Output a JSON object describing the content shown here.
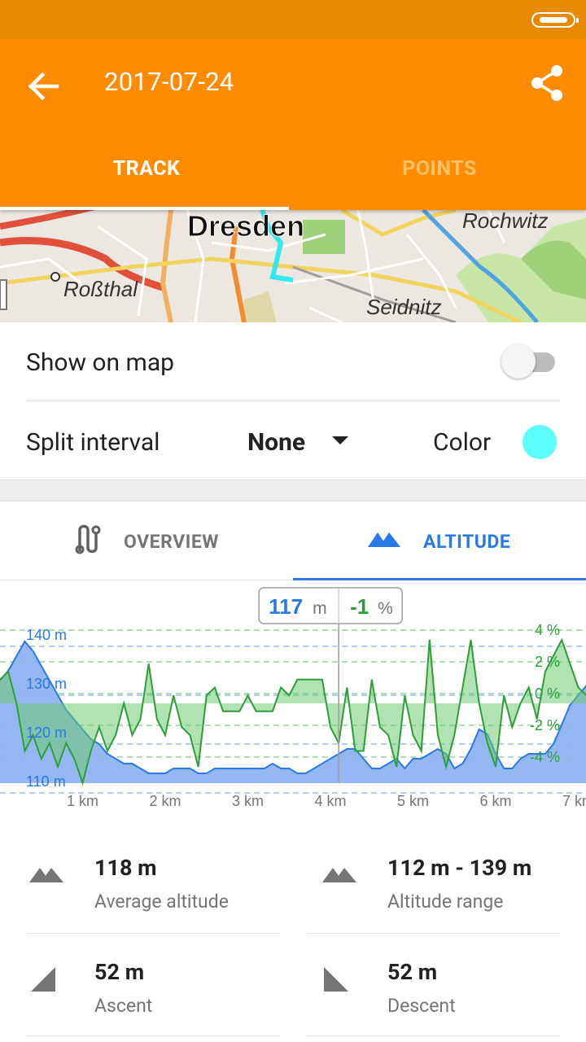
{
  "app_bar": {
    "title": "2017-07-24",
    "tabs": [
      {
        "label": "TRACK",
        "active": true
      },
      {
        "label": "POINTS",
        "active": false
      }
    ],
    "accent": "#FF8C00"
  },
  "map": {
    "labels": [
      "Dresden",
      "Rochwitz",
      "Roßthal",
      "Seidnitz"
    ]
  },
  "settings": {
    "show_on_map_label": "Show on map",
    "show_on_map_on": false,
    "split_interval_label": "Split interval",
    "split_interval_value": "None",
    "color_label": "Color",
    "track_color": "#5CFFFF"
  },
  "analysis_tabs": [
    {
      "label": "OVERVIEW",
      "icon": "route-icon",
      "active": false
    },
    {
      "label": "ALTITUDE",
      "icon": "mountains-icon",
      "active": true
    }
  ],
  "tooltip": {
    "altitude_value": "117",
    "altitude_unit": "m",
    "slope_value": "-1",
    "slope_unit": "%"
  },
  "chart_data": {
    "type": "area",
    "x_unit": "km",
    "xlim": [
      0,
      7.1
    ],
    "x_ticks": [
      "1 km",
      "2 km",
      "3 km",
      "4 km",
      "5 km",
      "6 km",
      "7 km"
    ],
    "y_left_ticks": [
      "140 m",
      "130 m",
      "120 m",
      "110 m"
    ],
    "y_right_ticks": [
      "4 %",
      "2 %",
      "0 %",
      "-2 %",
      "-4 %"
    ],
    "cursor_km": 4.1,
    "series": [
      {
        "color": "#2979E8",
        "axis": "left",
        "x": [
          0,
          0.1,
          0.2,
          0.3,
          0.4,
          0.5,
          0.6,
          0.7,
          0.8,
          0.9,
          1.0,
          1.1,
          1.2,
          1.3,
          1.4,
          1.5,
          1.6,
          1.7,
          1.8,
          1.9,
          2.0,
          2.1,
          2.2,
          2.3,
          2.4,
          2.5,
          2.6,
          2.7,
          2.8,
          2.9,
          3.0,
          3.1,
          3.2,
          3.3,
          3.4,
          3.5,
          3.6,
          3.7,
          3.8,
          3.9,
          4.0,
          4.1,
          4.2,
          4.3,
          4.4,
          4.5,
          4.6,
          4.7,
          4.8,
          4.9,
          5.0,
          5.1,
          5.2,
          5.3,
          5.4,
          5.5,
          5.6,
          5.7,
          5.8,
          5.9,
          6.0,
          6.1,
          6.2,
          6.3,
          6.4,
          6.5,
          6.6,
          6.7,
          6.8,
          6.9,
          7.0,
          7.1
        ],
        "values": [
          131,
          133,
          136,
          139,
          137,
          134,
          131,
          128,
          125,
          123,
          121,
          119,
          118,
          116,
          115,
          114,
          114,
          113,
          112,
          112,
          112,
          113,
          113,
          113,
          112,
          112,
          113,
          113,
          113,
          113,
          113,
          113,
          113,
          114,
          113,
          113,
          112,
          112,
          113,
          114,
          115,
          116,
          117,
          117,
          115,
          113,
          113,
          114,
          115,
          113,
          115,
          115,
          116,
          117,
          116,
          113,
          114,
          117,
          121,
          120,
          116,
          113,
          113,
          115,
          116,
          116,
          116,
          118,
          122,
          126,
          128,
          130
        ]
      },
      {
        "color": "#2E9E3A",
        "axis": "right",
        "x": [
          0,
          0.1,
          0.2,
          0.3,
          0.4,
          0.5,
          0.6,
          0.7,
          0.8,
          0.9,
          1.0,
          1.1,
          1.2,
          1.3,
          1.4,
          1.5,
          1.6,
          1.7,
          1.8,
          1.9,
          2.0,
          2.1,
          2.2,
          2.3,
          2.4,
          2.5,
          2.6,
          2.7,
          2.8,
          2.9,
          3.0,
          3.1,
          3.2,
          3.3,
          3.4,
          3.5,
          3.6,
          3.7,
          3.8,
          3.9,
          4.0,
          4.1,
          4.2,
          4.3,
          4.4,
          4.5,
          4.6,
          4.7,
          4.8,
          4.9,
          5.0,
          5.1,
          5.2,
          5.3,
          5.4,
          5.5,
          5.6,
          5.7,
          5.8,
          5.9,
          6.0,
          6.1,
          6.2,
          6.3,
          6.4,
          6.5,
          6.6,
          6.7,
          6.8,
          6.9,
          7.0,
          7.1
        ],
        "values": [
          1.5,
          2.0,
          0.0,
          -3.0,
          -2.0,
          -3.5,
          -2.5,
          -4.0,
          -2.5,
          -3.5,
          -5.0,
          -3.0,
          -1.5,
          -3.0,
          -2.0,
          0.0,
          -2.0,
          -1.0,
          2.5,
          -1.0,
          -2.0,
          0.5,
          -1.5,
          -2.0,
          -4.0,
          0.5,
          1.0,
          -0.5,
          -0.5,
          -0.5,
          0.5,
          -0.5,
          -0.5,
          -0.5,
          1.0,
          0.5,
          1.5,
          1.5,
          1.5,
          1.5,
          -1.5,
          -2.5,
          1.0,
          -3.0,
          -3.0,
          1.5,
          -1.5,
          -2.0,
          -4.0,
          0.5,
          -2.0,
          -3.0,
          4.0,
          -2.0,
          -4.0,
          -2.0,
          1.0,
          4.0,
          0.0,
          -2.5,
          -4.0,
          0.5,
          -1.5,
          0.0,
          1.0,
          -1.0,
          2.0,
          3.0,
          4.0,
          2.5,
          1.0,
          0.5
        ]
      }
    ]
  },
  "stats": [
    {
      "icon": "mountains-icon",
      "value": "118 m",
      "label": "Average altitude"
    },
    {
      "icon": "mountains-icon",
      "value": "112 m - 139 m",
      "label": "Altitude range"
    },
    {
      "icon": "ascent-icon",
      "value": "52 m",
      "label": "Ascent"
    },
    {
      "icon": "descent-icon",
      "value": "52 m",
      "label": "Descent"
    }
  ]
}
